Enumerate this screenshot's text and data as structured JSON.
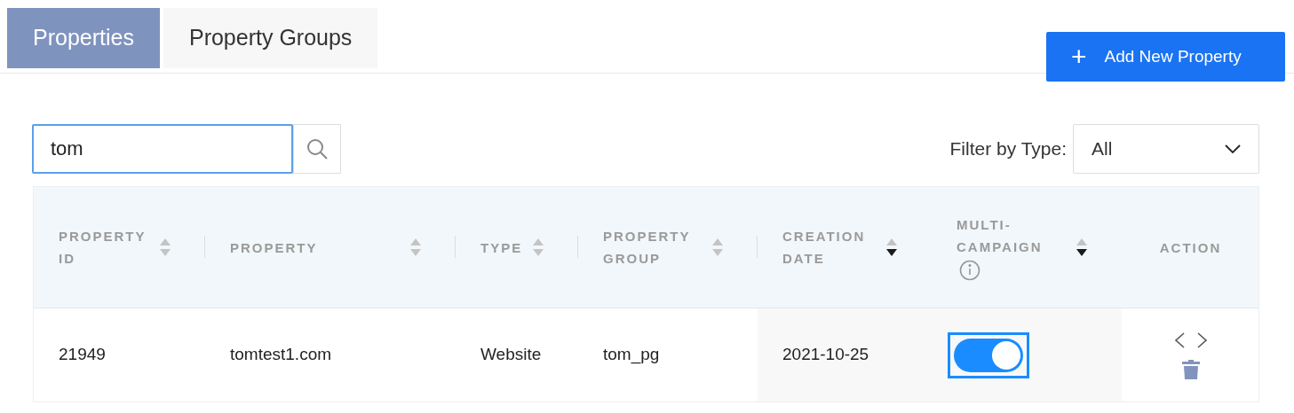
{
  "tabs": [
    {
      "label": "Properties",
      "selected": true
    },
    {
      "label": "Property Groups",
      "selected": false
    }
  ],
  "add_button": {
    "icon": "+",
    "label": "Add New Property"
  },
  "search": {
    "value": "tom"
  },
  "filter": {
    "label": "Filter by Type:",
    "value": "All"
  },
  "table": {
    "columns": [
      {
        "label": "PROPERTY ID",
        "sorted": false
      },
      {
        "label": "PROPERTY",
        "sorted": false
      },
      {
        "label": "TYPE",
        "sorted": false
      },
      {
        "label": "PROPERTY GROUP",
        "sorted": false
      },
      {
        "label": "CREATION DATE",
        "sorted": true
      },
      {
        "label": "MULTI-CAMPAIGN",
        "sorted": true,
        "info": true
      },
      {
        "label": "ACTION"
      }
    ],
    "rows": [
      {
        "cells": [
          "21949",
          "tomtest1.com",
          "Website",
          "tom_pg",
          "2021-10-25"
        ],
        "multi_campaign": {
          "on": true,
          "focused": true
        }
      }
    ]
  }
}
